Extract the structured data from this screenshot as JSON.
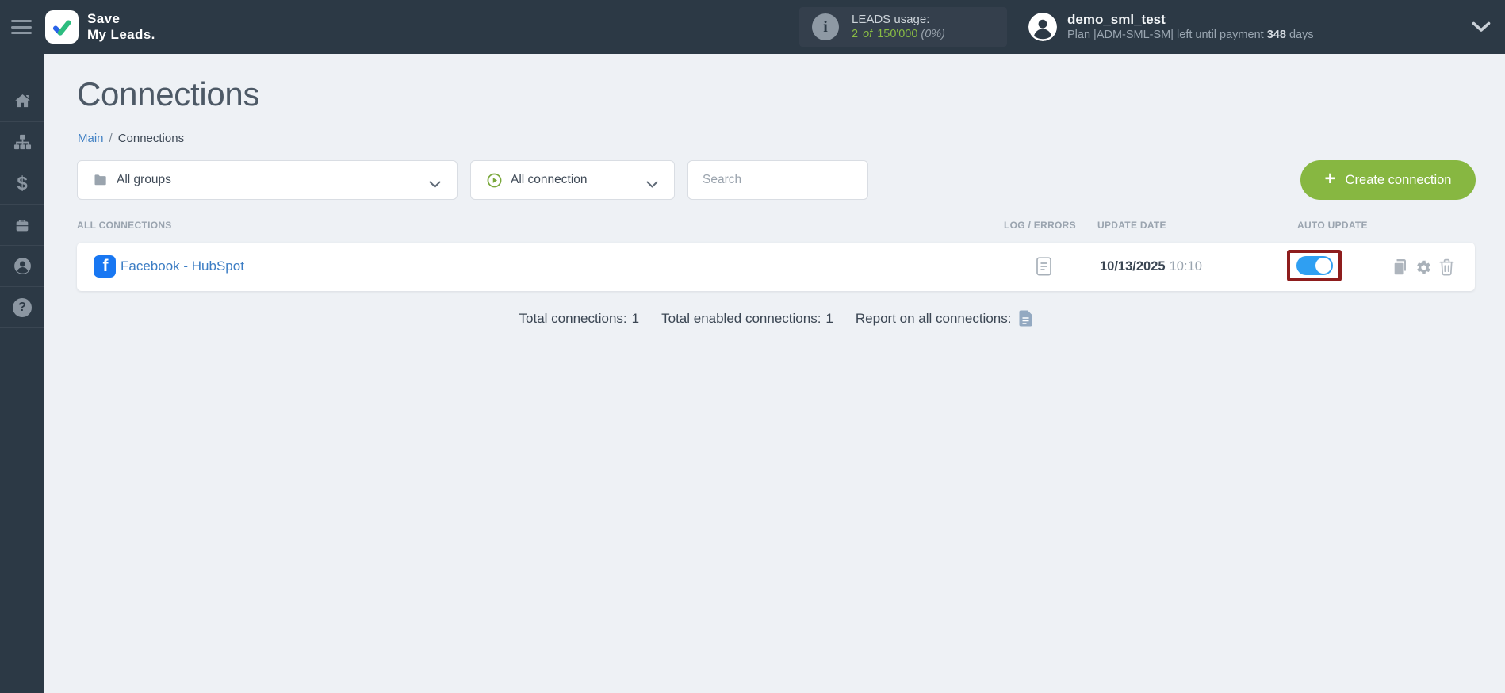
{
  "topbar": {
    "brand": {
      "line1": "Save",
      "line2": "My Leads."
    },
    "leads": {
      "label": "LEADS usage:",
      "used": "2",
      "of": "of",
      "total": "150'000",
      "percent": "(0%)"
    },
    "user": {
      "name": "demo_sml_test",
      "plan_prefix": "Plan |ADM-SML-SM| left until payment",
      "days": "348",
      "plan_suffix": "days"
    }
  },
  "icons": {
    "info_glyph": "i",
    "question_glyph": "?",
    "dollar_glyph": "$",
    "plus_glyph": "+",
    "facebook_glyph": "f"
  },
  "sidebar": {
    "items": [
      {
        "icon": "home-icon"
      },
      {
        "icon": "sitemap-icon"
      },
      {
        "icon": "dollar-icon"
      },
      {
        "icon": "briefcase-icon"
      },
      {
        "icon": "user-icon"
      },
      {
        "icon": "help-icon"
      }
    ]
  },
  "page": {
    "title": "Connections",
    "breadcrumb": {
      "main": "Main",
      "separator": "/",
      "current": "Connections"
    }
  },
  "filters": {
    "groups_label": "All groups",
    "connection_label": "All connection",
    "search_placeholder": "Search"
  },
  "actions": {
    "create_connection": "Create connection"
  },
  "table": {
    "headers": {
      "all": "ALL CONNECTIONS",
      "log": "LOG / ERRORS",
      "update": "UPDATE DATE",
      "auto": "AUTO UPDATE"
    },
    "rows": [
      {
        "name": "Facebook - HubSpot",
        "service_icon": "facebook-icon",
        "update_date": "10/13/2025",
        "update_time": "10:10",
        "auto_update": true
      }
    ]
  },
  "summary": {
    "total_label": "Total connections:",
    "total_value": "1",
    "enabled_label": "Total enabled connections:",
    "enabled_value": "1",
    "report_label": "Report on all connections:"
  },
  "colors": {
    "topbar": "#2c3945",
    "accent_green": "#87b741",
    "usage_green": "#88bb44",
    "link_blue": "#3c7dc4",
    "facebook_blue": "#1877f2",
    "toggle_blue": "#2f9ff2",
    "highlight_red": "#8e1d1d",
    "main_background": "#eef1f5"
  }
}
